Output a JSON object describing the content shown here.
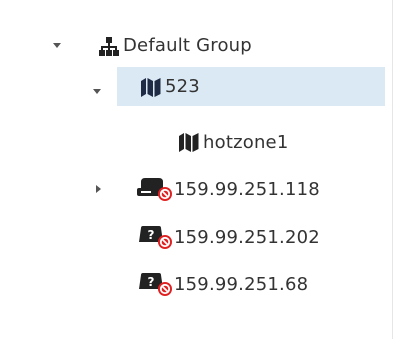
{
  "tree": {
    "root": {
      "label": "Default Group",
      "icon": "network-group-icon",
      "expanded": true
    },
    "items": [
      {
        "label": "523",
        "icon": "map-icon",
        "expanded": true,
        "selected": true
      },
      {
        "label": "hotzone1",
        "icon": "map-icon"
      },
      {
        "label": "159.99.251.118",
        "icon": "device-offline-icon",
        "expanded": false
      },
      {
        "label": "159.99.251.202",
        "icon": "device-unknown-offline-icon"
      },
      {
        "label": "159.99.251.68",
        "icon": "device-unknown-offline-icon"
      }
    ]
  },
  "colors": {
    "selected_bg": "#dbe9f5",
    "icon_dark": "#222222",
    "status_red": "#e02020",
    "text": "#333333"
  }
}
